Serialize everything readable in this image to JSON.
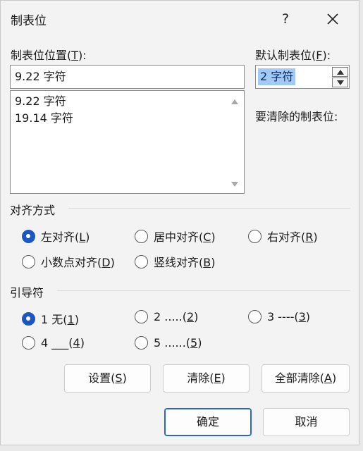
{
  "window": {
    "title": "制表位",
    "help_label": "?"
  },
  "tab_position": {
    "label": "制表位位置(",
    "label_key": "T",
    "label_tail": "):",
    "value": "9.22 字符",
    "list_items": [
      "9.22 字符",
      "19.14 字符"
    ]
  },
  "default_tab": {
    "label": "默认制表位(",
    "label_key": "F",
    "label_tail": "):",
    "value": "2 字符"
  },
  "to_clear": {
    "label": "要清除的制表位:"
  },
  "alignment": {
    "heading": "对齐方式",
    "options": [
      {
        "text": "左对齐(",
        "key": "L",
        "tail": ")",
        "checked": true
      },
      {
        "text": "居中对齐(",
        "key": "C",
        "tail": ")",
        "checked": false
      },
      {
        "text": "右对齐(",
        "key": "R",
        "tail": ")",
        "checked": false
      },
      {
        "text": "小数点对齐(",
        "key": "D",
        "tail": ")",
        "checked": false
      },
      {
        "text": "竖线对齐(",
        "key": "B",
        "tail": ")",
        "checked": false
      }
    ]
  },
  "leader": {
    "heading": "引导符",
    "options": [
      {
        "text": "1 无(",
        "key": "1",
        "tail": ")",
        "checked": true
      },
      {
        "text": "2 .....(",
        "key": "2",
        "tail": ")",
        "checked": false
      },
      {
        "text": "3 ----(",
        "key": "3",
        "tail": ")",
        "checked": false
      },
      {
        "text": "4 ___(",
        "key": "4",
        "tail": ")",
        "checked": false
      },
      {
        "text": "5 ......(",
        "key": "5",
        "tail": ")",
        "checked": false
      }
    ]
  },
  "buttons": {
    "set": {
      "text": "设置(",
      "key": "S",
      "tail": ")"
    },
    "clear": {
      "text": "清除(",
      "key": "E",
      "tail": ")"
    },
    "clear_all": {
      "text": "全部清除(",
      "key": "A",
      "tail": ")"
    },
    "ok": "确定",
    "cancel": "取消"
  },
  "colors": {
    "accent": "#1a56c4",
    "selection": "#a3c9f5"
  }
}
